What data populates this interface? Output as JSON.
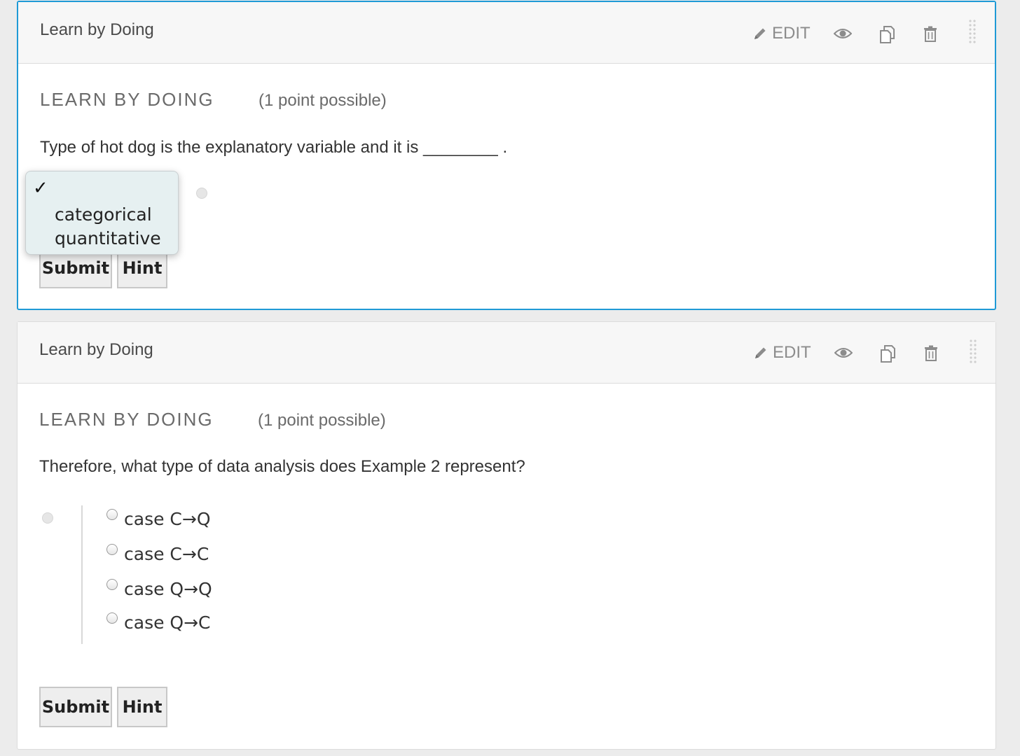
{
  "edit_label": "EDIT",
  "problem1": {
    "header_title": "Learn by Doing",
    "heading": "LEARN BY DOING",
    "points": "(1 point possible)",
    "question": "Type of hot dog is the explanatory variable and it is ________ .",
    "dropdown": {
      "checked_marker": "✓",
      "options": [
        "categorical",
        "quantitative"
      ]
    },
    "submit_label": "Submit",
    "hint_label": "Hint"
  },
  "problem2": {
    "header_title": "Learn by Doing",
    "heading": "LEARN BY DOING",
    "points": "(1 point possible)",
    "question": "Therefore, what type of data analysis does Example 2 represent?",
    "choices": [
      "case C→Q",
      "case C→C",
      "case Q→Q",
      "case Q→C"
    ],
    "submit_label": "Submit",
    "hint_label": "Hint"
  },
  "icons": [
    "pencil-icon",
    "eye-icon",
    "duplicate-icon",
    "trash-icon",
    "drag-handle-icon"
  ],
  "colors": {
    "active_border": "#1f9ad6",
    "header_bg": "#f7f7f7",
    "dropdown_bg": "#e6f0f1"
  }
}
